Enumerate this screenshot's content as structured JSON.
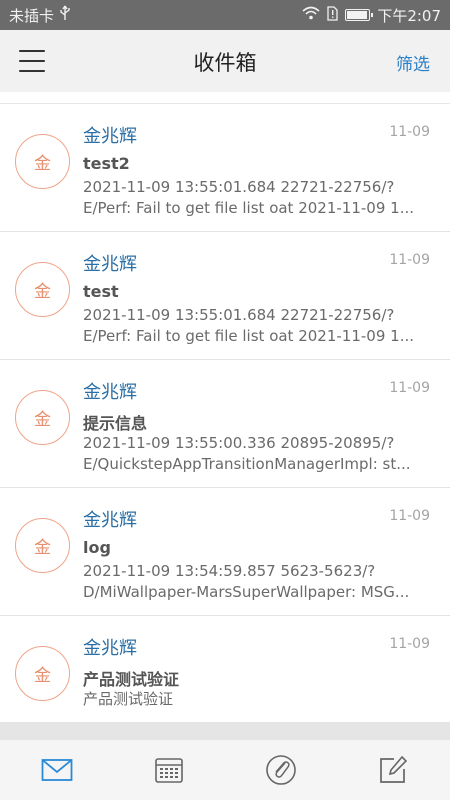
{
  "status_bar": {
    "carrier": "未插卡",
    "usb_icon": "usb-icon",
    "wifi_icon": "wifi-icon",
    "sim_alert_icon": "sim-alert-icon",
    "battery_level": 0.95,
    "time": "下午2:07"
  },
  "header": {
    "menu_icon": "menu-icon",
    "title": "收件箱",
    "filter_label": "筛选"
  },
  "mails": [
    {
      "avatar": "金",
      "sender": "金兆辉",
      "date": "11-09",
      "subject": "test2",
      "preview_line1": "2021-11-09 13:55:01.684 22721-22756/?",
      "preview_line2": "E/Perf: Fail to get file list oat 2021-11-09 1..."
    },
    {
      "avatar": "金",
      "sender": "金兆辉",
      "date": "11-09",
      "subject": "test",
      "preview_line1": "2021-11-09 13:55:01.684 22721-22756/?",
      "preview_line2": "E/Perf: Fail to get file list oat 2021-11-09 1..."
    },
    {
      "avatar": "金",
      "sender": "金兆辉",
      "date": "11-09",
      "subject": "提示信息",
      "preview_line1": "2021-11-09 13:55:00.336 20895-20895/?",
      "preview_line2": "E/QuickstepAppTransitionManagerImpl: st..."
    },
    {
      "avatar": "金",
      "sender": "金兆辉",
      "date": "11-09",
      "subject": "log",
      "preview_line1": "2021-11-09 13:54:59.857 5623-5623/?",
      "preview_line2": "D/MiWallpaper-MarsSuperWallpaper: MSG..."
    },
    {
      "avatar": "金",
      "sender": "金兆辉",
      "date": "11-09",
      "subject": "产品测试验证",
      "preview_line1": "产品测试验证",
      "preview_line2": ""
    }
  ],
  "bottom_nav": {
    "mail_icon": "mail-icon",
    "calendar_icon": "calendar-icon",
    "attachment_icon": "paperclip-icon",
    "compose_icon": "compose-icon",
    "active_color": "#2b8ad6",
    "inactive_color": "#666666"
  }
}
